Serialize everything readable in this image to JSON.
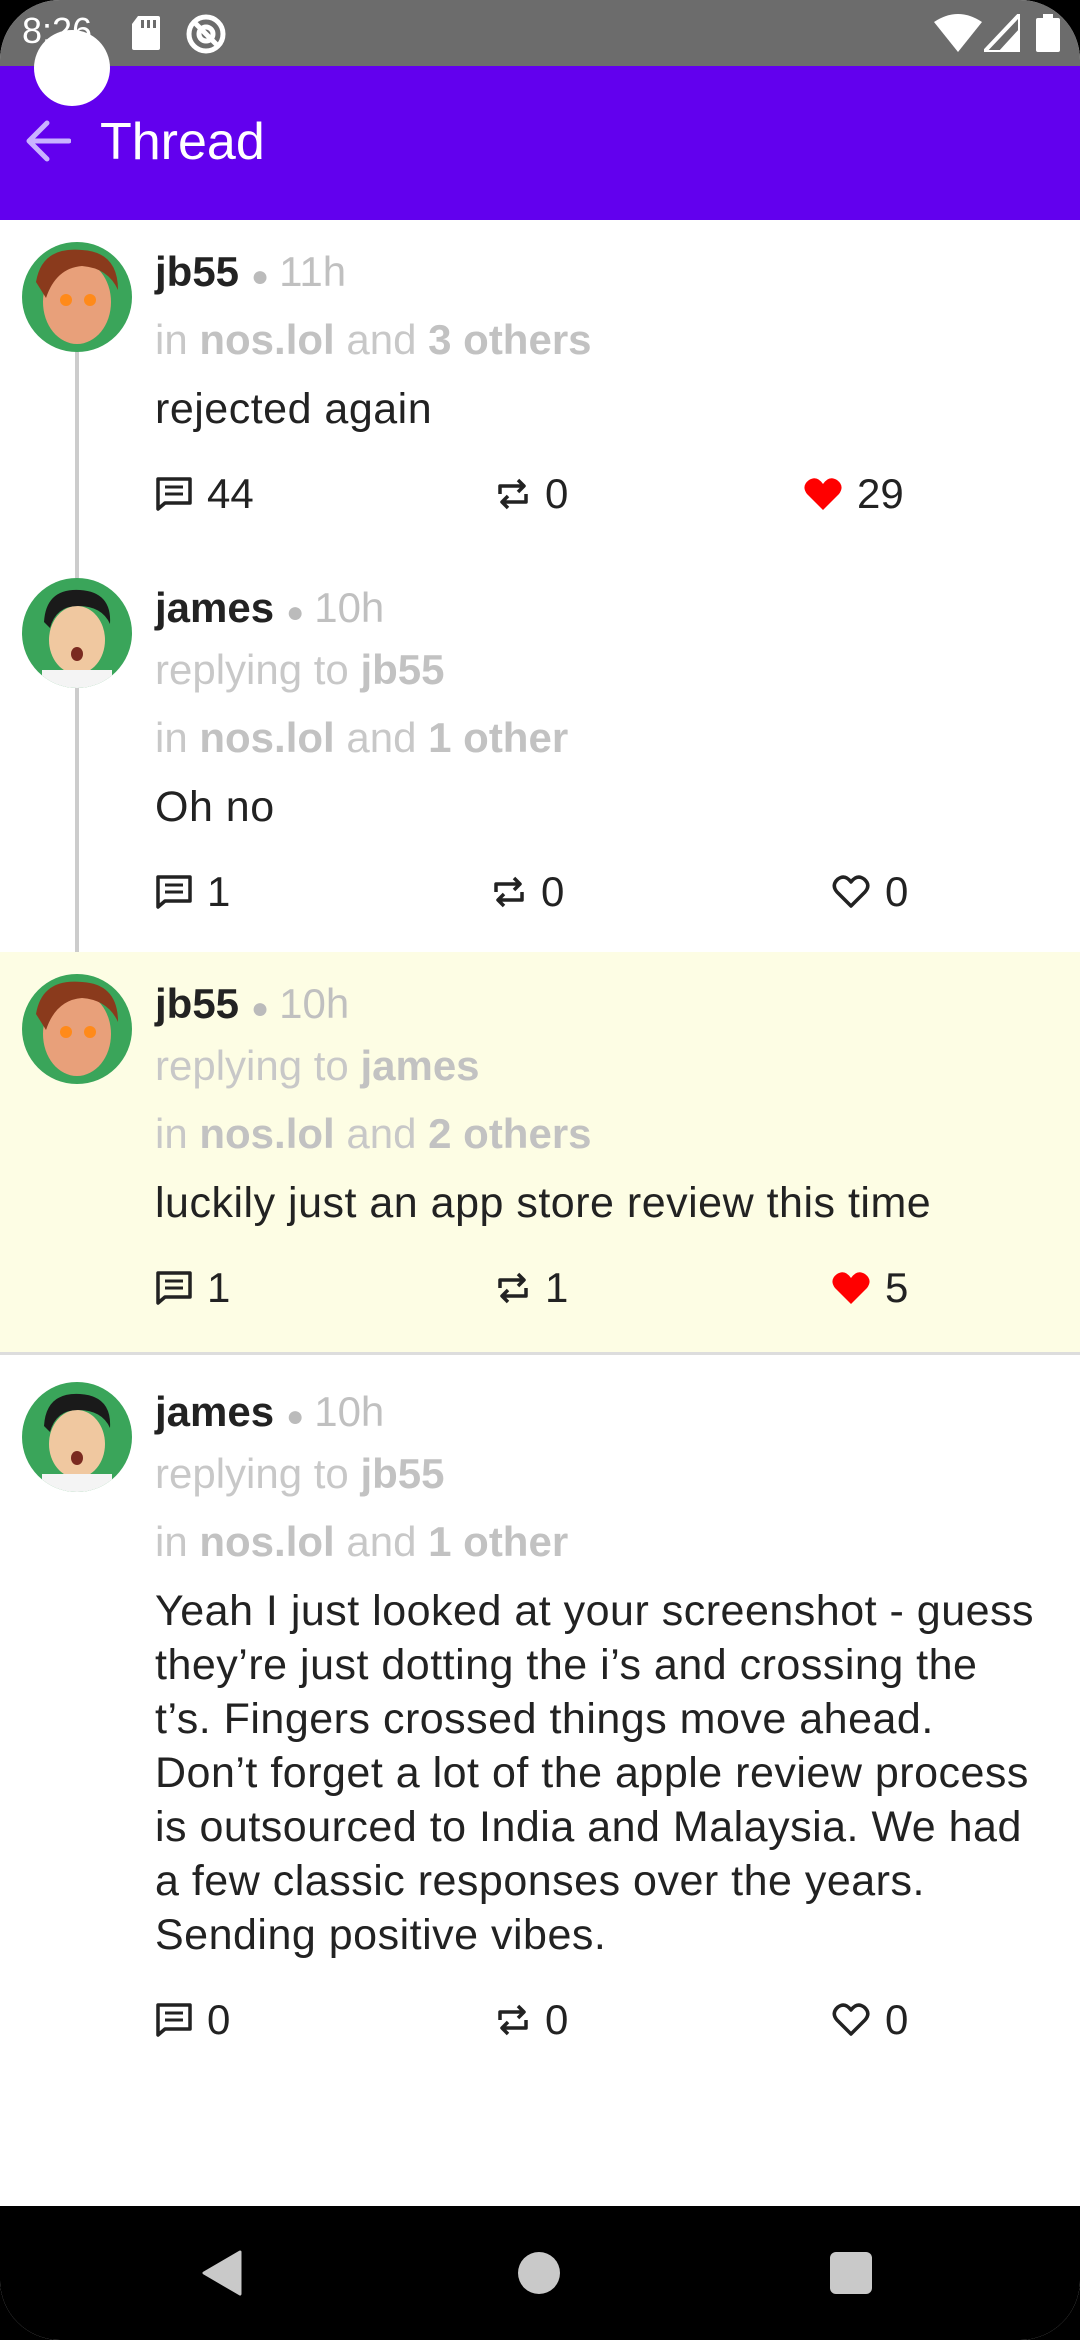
{
  "status_bar": {
    "time": "8:26",
    "icons": [
      "sd-card-icon",
      "at-sign-icon",
      "wifi-icon",
      "signal-icon",
      "battery-icon"
    ]
  },
  "app_bar": {
    "title": "Thread",
    "back_icon": "arrow-left-icon",
    "color": "#6200ee"
  },
  "notes": [
    {
      "author": "jb55",
      "time": "11h",
      "reply_to_prefix": "",
      "reply_to": "",
      "relay_prefix": "in",
      "relay": "nos.lol",
      "relay_conj": "and",
      "relay_others": "3 others",
      "body": "rejected again",
      "replies": "44",
      "reposts": "0",
      "likes": "29",
      "liked": true
    },
    {
      "author": "james",
      "time": "10h",
      "reply_to_prefix": "replying to",
      "reply_to": "jb55",
      "relay_prefix": "in",
      "relay": "nos.lol",
      "relay_conj": "and",
      "relay_others": "1 other",
      "body": "Oh no",
      "replies": "1",
      "reposts": "0",
      "likes": "0",
      "liked": false
    },
    {
      "author": "jb55",
      "time": "10h",
      "reply_to_prefix": "replying to",
      "reply_to": "james",
      "relay_prefix": "in",
      "relay": "nos.lol",
      "relay_conj": "and",
      "relay_others": "2 others",
      "body": "luckily just an app store review this time",
      "replies": "1",
      "reposts": "1",
      "likes": "5",
      "liked": true,
      "highlight_color": "#fdfde4"
    },
    {
      "author": "james",
      "time": "10h",
      "reply_to_prefix": "replying to",
      "reply_to": "jb55",
      "relay_prefix": "in",
      "relay": "nos.lol",
      "relay_conj": "and",
      "relay_others": "1 other",
      "body": "Yeah I just looked at your screenshot - guess they’re just dotting the i’s and crossing the t’s. Fingers crossed things move ahead. Don’t forget a lot of the apple review process is outsourced to India and Malaysia. We had a few classic responses over the years. Sending positive vibes.",
      "replies": "0",
      "reposts": "0",
      "likes": "0",
      "liked": false
    }
  ],
  "colors": {
    "like_active": "#ff0000",
    "muted_text": "#c8c8c8"
  },
  "nav_bar": {
    "icons": [
      "nav-back-icon",
      "nav-home-icon",
      "nav-recents-icon"
    ]
  }
}
